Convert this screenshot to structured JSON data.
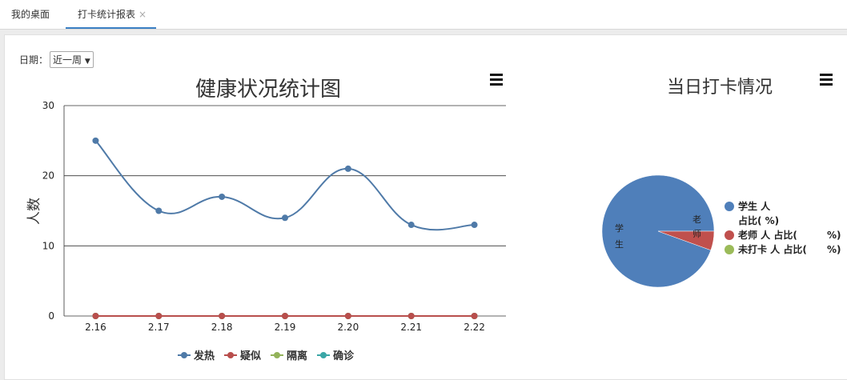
{
  "tabs": [
    {
      "label": "我的桌面"
    },
    {
      "label": "打卡统计报表",
      "close": "×"
    }
  ],
  "filter": {
    "label": "日期：",
    "value": "近一周",
    "arrow": "▼"
  },
  "line_chart": {
    "menu_icon": "hamburger-menu-icon"
  },
  "pie_chart": {
    "menu_icon": "hamburger-menu-icon"
  },
  "chart_data": [
    {
      "type": "line",
      "title": "健康状况统计图",
      "xlabel": "",
      "ylabel": "人数",
      "categories": [
        "2.16",
        "2.17",
        "2.18",
        "2.19",
        "2.20",
        "2.21",
        "2.22"
      ],
      "yticks": [
        "0",
        "10",
        "20",
        "30"
      ],
      "ylim": [
        0,
        30
      ],
      "grid": true,
      "legend_position": "bottom",
      "series": [
        {
          "name": "发热",
          "color": "#4f7aa8",
          "values": [
            25,
            15,
            17,
            14,
            21,
            13,
            13
          ]
        },
        {
          "name": "疑似",
          "color": "#b84e4c",
          "values": [
            0,
            0,
            0,
            0,
            0,
            0,
            0
          ]
        },
        {
          "name": "隔离",
          "color": "#93b35a",
          "values": [
            0,
            0,
            0,
            0,
            0,
            0,
            0
          ]
        },
        {
          "name": "确诊",
          "color": "#3aa6a6",
          "values": [
            0,
            0,
            0,
            0,
            0,
            0,
            0
          ]
        }
      ]
    },
    {
      "type": "pie",
      "title": "当日打卡情况",
      "legend_position": "right",
      "slice_labels": [
        "学生",
        "老师"
      ],
      "legend": [
        {
          "line1": "学生",
          "line1_rest": "人",
          "line2": "占比(",
          "line2_rest": "%)"
        },
        {
          "line1": "老师",
          "line1_rest": "人 占比(",
          "line2": "",
          "line2_rest": "%)"
        },
        {
          "line1": "未打卡",
          "line1_rest": "人 占比(",
          "line2": "",
          "line2_rest": "%)"
        }
      ],
      "series": [
        {
          "name": "学生",
          "color": "#4f7fba",
          "fraction": 0.945
        },
        {
          "name": "老师",
          "color": "#c0504d",
          "fraction": 0.055
        },
        {
          "name": "未打卡",
          "color": "#9bbb59",
          "fraction": 0.0
        }
      ]
    }
  ]
}
